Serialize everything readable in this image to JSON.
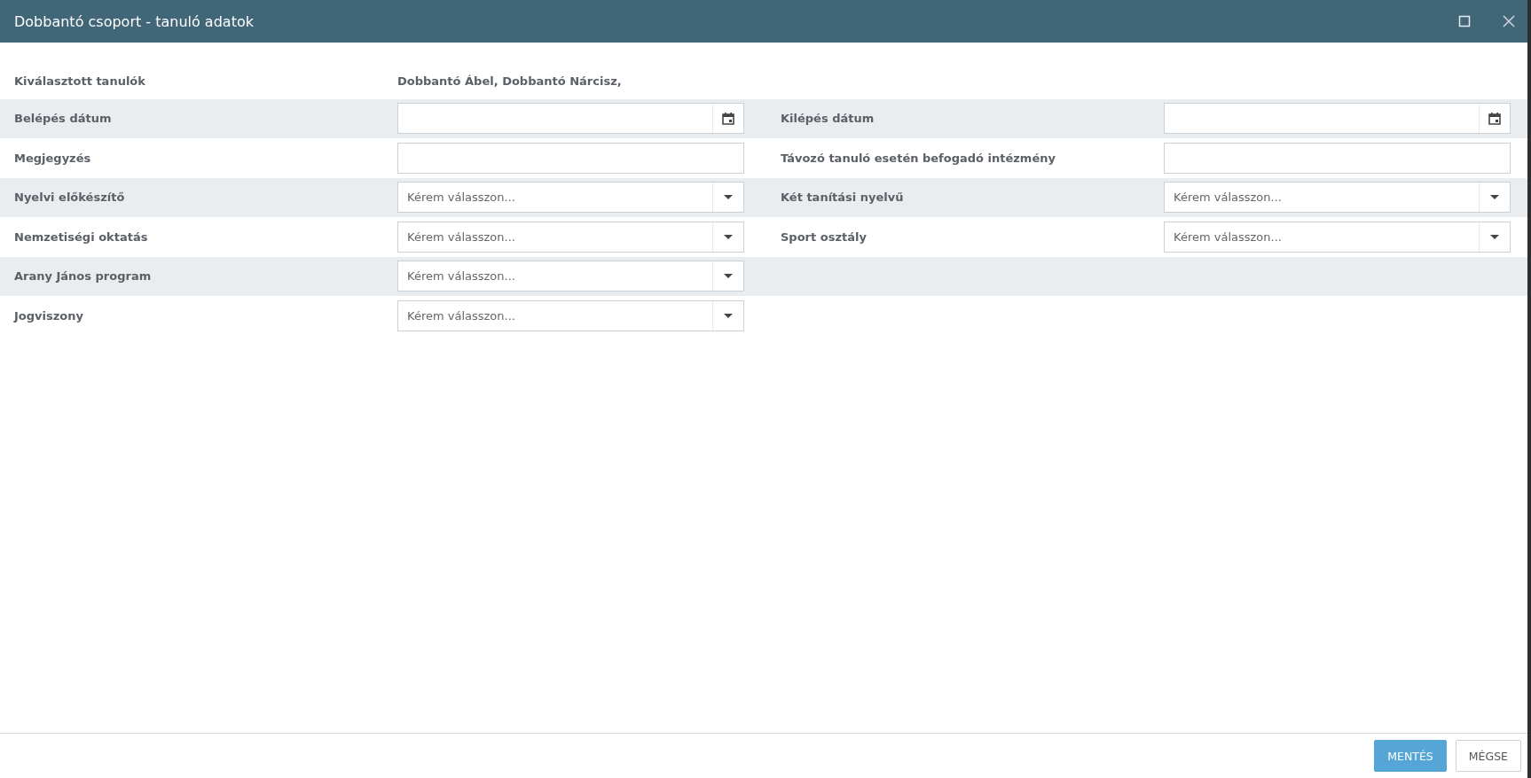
{
  "window": {
    "title": "Dobbantó csoport - tanuló adatok"
  },
  "rows": [
    {
      "fields": [
        {
          "kind": "text",
          "label": "Kiválasztott tanulók",
          "value": "Dobbantó Ábel, Dobbantó Nárcisz,"
        }
      ]
    },
    {
      "fields": [
        {
          "kind": "date",
          "label": "Belépés dátum"
        },
        {
          "kind": "date",
          "label": "Kilépés dátum"
        }
      ]
    },
    {
      "fields": [
        {
          "kind": "input",
          "label": "Megjegyzés"
        },
        {
          "kind": "input",
          "label": "Távozó tanuló esetén befogadó intézmény"
        }
      ]
    },
    {
      "fields": [
        {
          "kind": "select",
          "label": "Nyelvi előkészítő",
          "placeholder": "Kérem válasszon..."
        },
        {
          "kind": "select",
          "label": "Két tanítási nyelvű",
          "placeholder": "Kérem válasszon..."
        }
      ]
    },
    {
      "fields": [
        {
          "kind": "select",
          "label": "Nemzetiségi oktatás",
          "placeholder": "Kérem válasszon..."
        },
        {
          "kind": "select",
          "label": "Sport osztály",
          "placeholder": "Kérem válasszon..."
        }
      ]
    },
    {
      "fields": [
        {
          "kind": "select",
          "label": "Arany János program",
          "placeholder": "Kérem válasszon..."
        }
      ]
    },
    {
      "fields": [
        {
          "kind": "select",
          "label": "Jogviszony",
          "placeholder": "Kérem válasszon..."
        }
      ]
    }
  ],
  "buttons": [
    {
      "label": "MENTÉS",
      "kind": "primary"
    },
    {
      "label": "MÉGSE",
      "kind": "secondary"
    }
  ]
}
